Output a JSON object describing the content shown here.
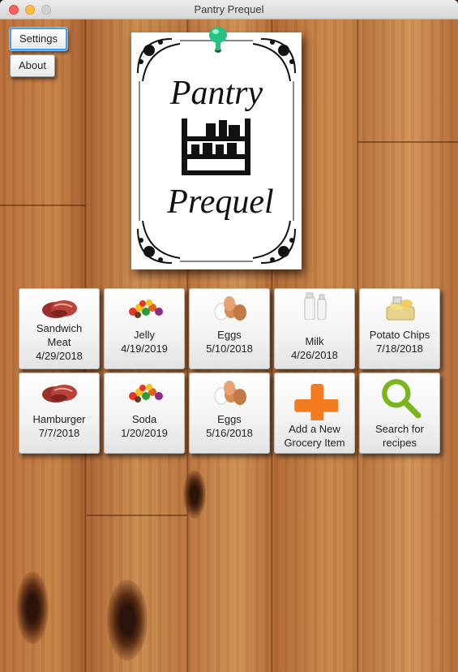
{
  "window": {
    "title": "Pantry Prequel"
  },
  "sidebar": {
    "settings_label": "Settings",
    "about_label": "About"
  },
  "logo": {
    "line1": "Pantry",
    "line2": "Prequel"
  },
  "items": [
    {
      "name": "Sandwich Meat",
      "date": "4/29/2018",
      "icon": "meat-icon"
    },
    {
      "name": "Jelly",
      "date": "4/19/2019",
      "icon": "candy-icon"
    },
    {
      "name": "Eggs",
      "date": "5/10/2018",
      "icon": "eggs-icon"
    },
    {
      "name": "Milk",
      "date": "4/26/2018",
      "icon": "milk-icon"
    },
    {
      "name": "Potato Chips",
      "date": "7/18/2018",
      "icon": "chips-icon"
    },
    {
      "name": "Hamburger",
      "date": "7/7/2018",
      "icon": "meat-icon"
    },
    {
      "name": "Soda",
      "date": "1/20/2019",
      "icon": "candy-icon"
    },
    {
      "name": "Eggs",
      "date": "5/16/2018",
      "icon": "eggs-icon"
    }
  ],
  "actions": {
    "add_label": "Add a New Grocery Item",
    "search_label": "Search for recipes"
  },
  "colors": {
    "add_accent": "#f47c20",
    "search_accent": "#7ab51d",
    "focus_ring": "#3aa0ff"
  }
}
